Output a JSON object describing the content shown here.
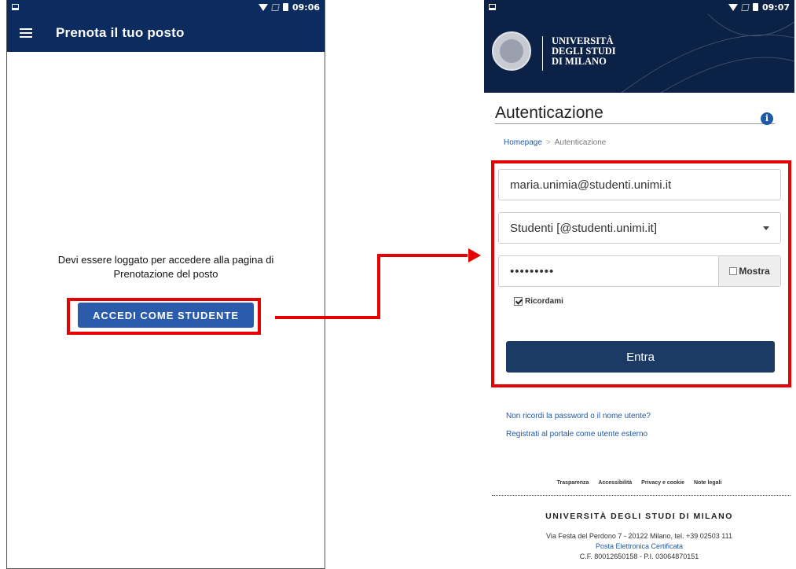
{
  "left_screen": {
    "status_time": "09:06",
    "app_title": "Prenota il tuo posto",
    "login_message": "Devi essere loggato per accedere alla pagina di Prenotazione del posto",
    "login_button": "ACCEDI COME STUDENTE"
  },
  "right_screen": {
    "status_time": "09:07",
    "university_name": [
      "UNIVERSITÀ",
      "DEGLI STUDI",
      "DI MILANO"
    ],
    "page_title": "Autenticazione",
    "breadcrumb": {
      "home": "Homepage",
      "separator": ">",
      "current": "Autenticazione"
    },
    "username_value": "maria.unimia@studenti.unimi.it",
    "domain_select": "Studenti [@studenti.unimi.it]",
    "password_mask": "•••••••••",
    "show_password_label": "Mostra",
    "remember_label": "Ricordami",
    "submit_button": "Entra",
    "forgot_link": "Non ricordi la password o il nome utente?",
    "register_link": "Registrati al portale come utente esterno",
    "footer_links": [
      "Trasparenza",
      "Accessibilità",
      "Privacy e cookie",
      "Note legali"
    ],
    "footer_university": "UNIVERSITÀ DEGLI STUDI DI MILANO",
    "footer_address": "Via Festa del Perdono 7 - 20122 Milano, tel. +39 02503 111",
    "footer_pec": "Posta Elettronica Certificata",
    "footer_fiscal": "C.F. 80012650158 - P.I. 03064870151"
  },
  "colors": {
    "app_bar": "#0c2b5e",
    "accent_button": "#2b5cab",
    "highlight": "#e60000",
    "submit_button": "#1b3a64",
    "link": "#1f5aa6"
  }
}
